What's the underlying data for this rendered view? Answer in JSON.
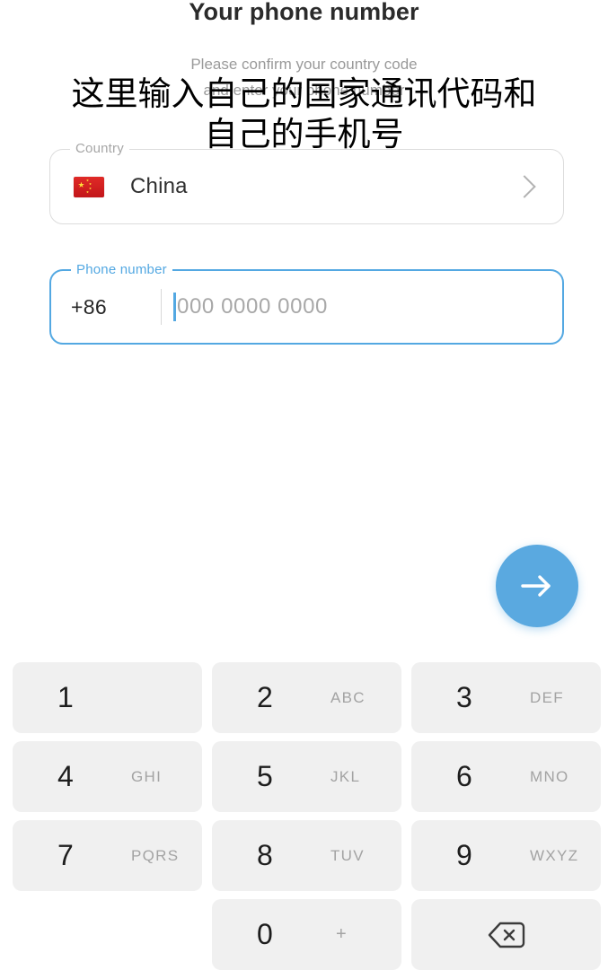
{
  "header": {
    "title": "Your phone number",
    "subtitle_line1": "Please confirm your country code",
    "subtitle_line2": "and enter your phone number"
  },
  "annotation": {
    "line1": "这里输入自己的国家通讯代码和",
    "line2": "自己的手机号"
  },
  "country_field": {
    "legend": "Country",
    "flag_icon": "china-flag-icon",
    "value": "China",
    "chevron_icon": "chevron-right-icon"
  },
  "phone_field": {
    "legend": "Phone number",
    "dial_code": "+86",
    "placeholder": "000 0000 0000",
    "value": ""
  },
  "next_button": {
    "icon": "arrow-right-icon",
    "label": "Next"
  },
  "keypad": {
    "keys": [
      {
        "digit": "1",
        "letters": "",
        "name": "key-1"
      },
      {
        "digit": "2",
        "letters": "ABC",
        "name": "key-2"
      },
      {
        "digit": "3",
        "letters": "DEF",
        "name": "key-3"
      },
      {
        "digit": "4",
        "letters": "GHI",
        "name": "key-4"
      },
      {
        "digit": "5",
        "letters": "JKL",
        "name": "key-5"
      },
      {
        "digit": "6",
        "letters": "MNO",
        "name": "key-6"
      },
      {
        "digit": "7",
        "letters": "PQRS",
        "name": "key-7"
      },
      {
        "digit": "8",
        "letters": "TUV",
        "name": "key-8"
      },
      {
        "digit": "9",
        "letters": "WXYZ",
        "name": "key-9"
      },
      {
        "digit": "0",
        "letters": "+",
        "name": "key-0"
      }
    ],
    "backspace_icon": "backspace-icon"
  },
  "colors": {
    "accent": "#53a8e2",
    "fab": "#5aa9e0",
    "key_bg": "#f0f0f0",
    "field_border": "#dcdcdc",
    "muted_text": "#9a9a9a",
    "flag_red": "#c2161a",
    "flag_yellow": "#ffde3a"
  }
}
